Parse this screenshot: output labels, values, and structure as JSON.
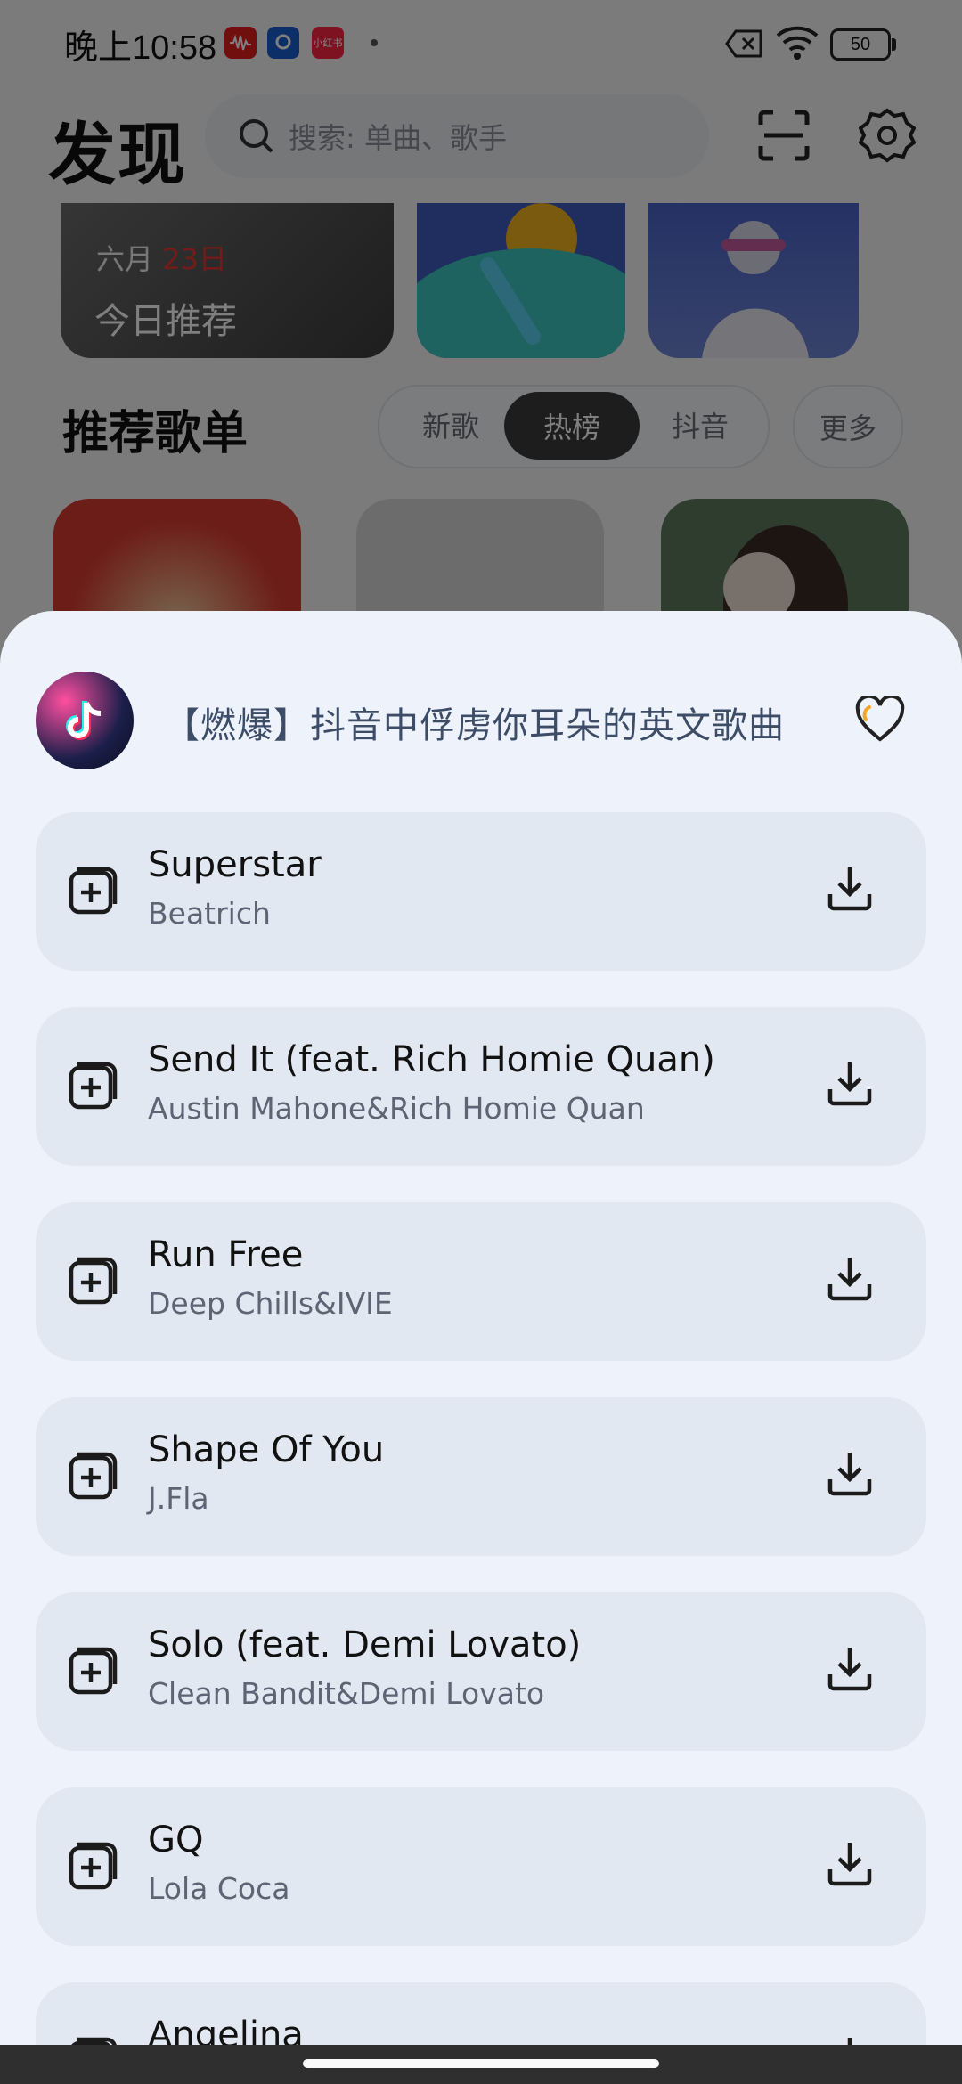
{
  "status_bar": {
    "time": "晚上10:58",
    "battery": "50",
    "badges": [
      "audio-app-icon",
      "browser-app-icon",
      "xiaohongshu-app-icon"
    ],
    "badge_texts": [
      "",
      "",
      "小红书"
    ]
  },
  "header": {
    "title": "发现",
    "search_placeholder": "搜索: 单曲、歌手"
  },
  "cards": {
    "date_month": "六月",
    "date_day": "23日",
    "today_label": "今日推荐"
  },
  "playlists": {
    "title": "推荐歌单",
    "tabs": [
      "新歌",
      "热榜",
      "抖音"
    ],
    "active_tab": "热榜",
    "more": "更多"
  },
  "sheet": {
    "title": "【燃爆】抖音中俘虏你耳朵的英文歌曲",
    "songs": [
      {
        "name": "Superstar",
        "artist": "Beatrich"
      },
      {
        "name": "Send It (feat. Rich Homie Quan)",
        "artist": "Austin Mahone&Rich Homie Quan"
      },
      {
        "name": "Run Free",
        "artist": "Deep Chills&IVIE"
      },
      {
        "name": "Shape Of You",
        "artist": "J.Fla"
      },
      {
        "name": "Solo (feat. Demi Lovato)",
        "artist": "Clean Bandit&Demi Lovato"
      },
      {
        "name": "GQ",
        "artist": "Lola Coca"
      },
      {
        "name": "Angelina",
        "artist": ""
      }
    ]
  },
  "colors": {
    "sheet_bg": "#eef3fb",
    "song_card_bg": "#e2e8f1",
    "title_text": "#3d4d67",
    "accent_red": "#e53935"
  }
}
